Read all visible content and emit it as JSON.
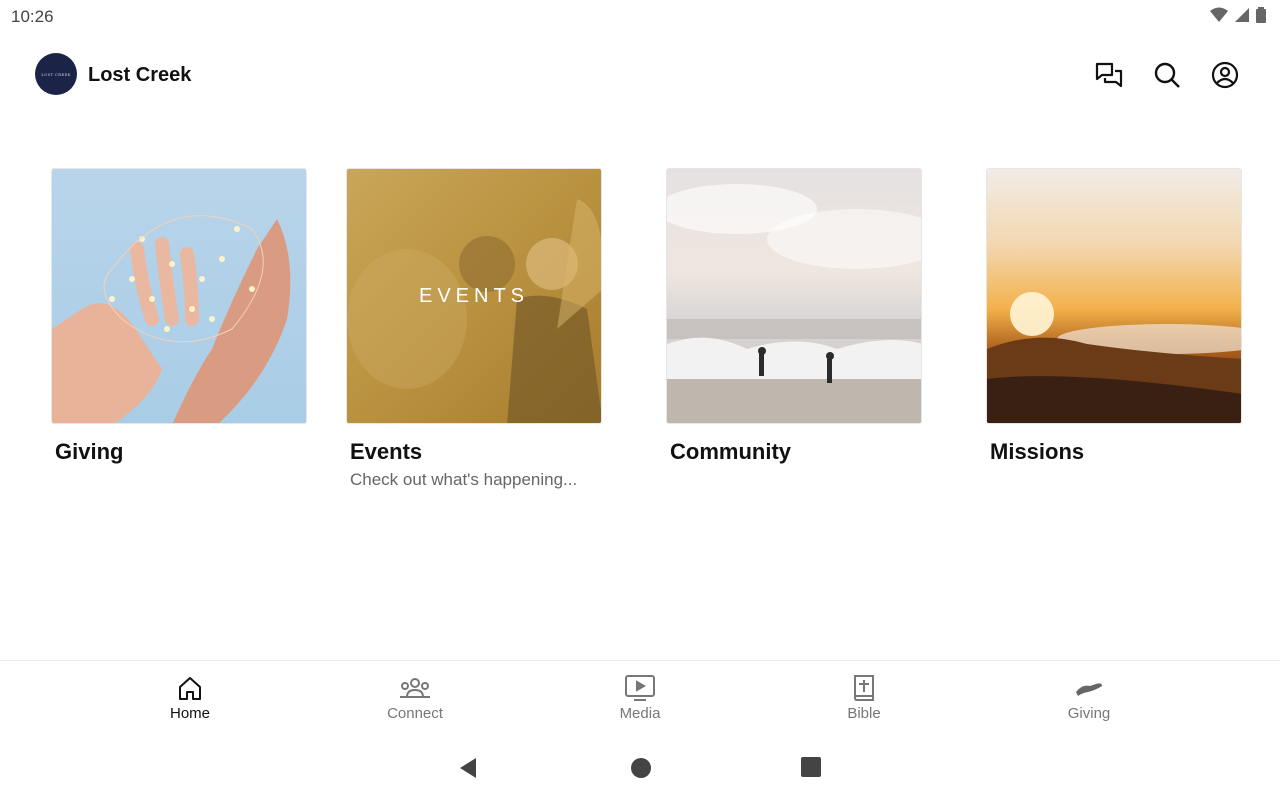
{
  "status_bar": {
    "time": "10:26",
    "icons": [
      "wifi-icon",
      "signal-icon",
      "battery-icon"
    ]
  },
  "header": {
    "logo_text": "LOST CREEK",
    "title": "Lost Creek",
    "actions": [
      "chat-icon",
      "search-icon",
      "account-icon"
    ]
  },
  "cards": [
    {
      "title": "Giving",
      "subtitle": "",
      "image": "hands-holding-lights"
    },
    {
      "title": "Events",
      "subtitle": "Check out what's happening...",
      "image": "people-laughing",
      "overlay": "EVENTS"
    },
    {
      "title": "Community",
      "subtitle": "",
      "image": "surfers-on-beach"
    },
    {
      "title": "Missions",
      "subtitle": "",
      "image": "sunset-over-clouds"
    }
  ],
  "bottom_nav": [
    {
      "label": "Home",
      "icon": "home-icon",
      "active": true
    },
    {
      "label": "Connect",
      "icon": "people-icon",
      "active": false
    },
    {
      "label": "Media",
      "icon": "play-screen-icon",
      "active": false
    },
    {
      "label": "Bible",
      "icon": "bible-icon",
      "active": false
    },
    {
      "label": "Giving",
      "icon": "giving-hand-icon",
      "active": false
    }
  ],
  "system_nav": [
    "back-icon",
    "home-circle-icon",
    "recents-icon"
  ],
  "colors": {
    "logo_bg": "#1b2446",
    "active_nav": "#111111",
    "inactive_nav": "#777777"
  }
}
